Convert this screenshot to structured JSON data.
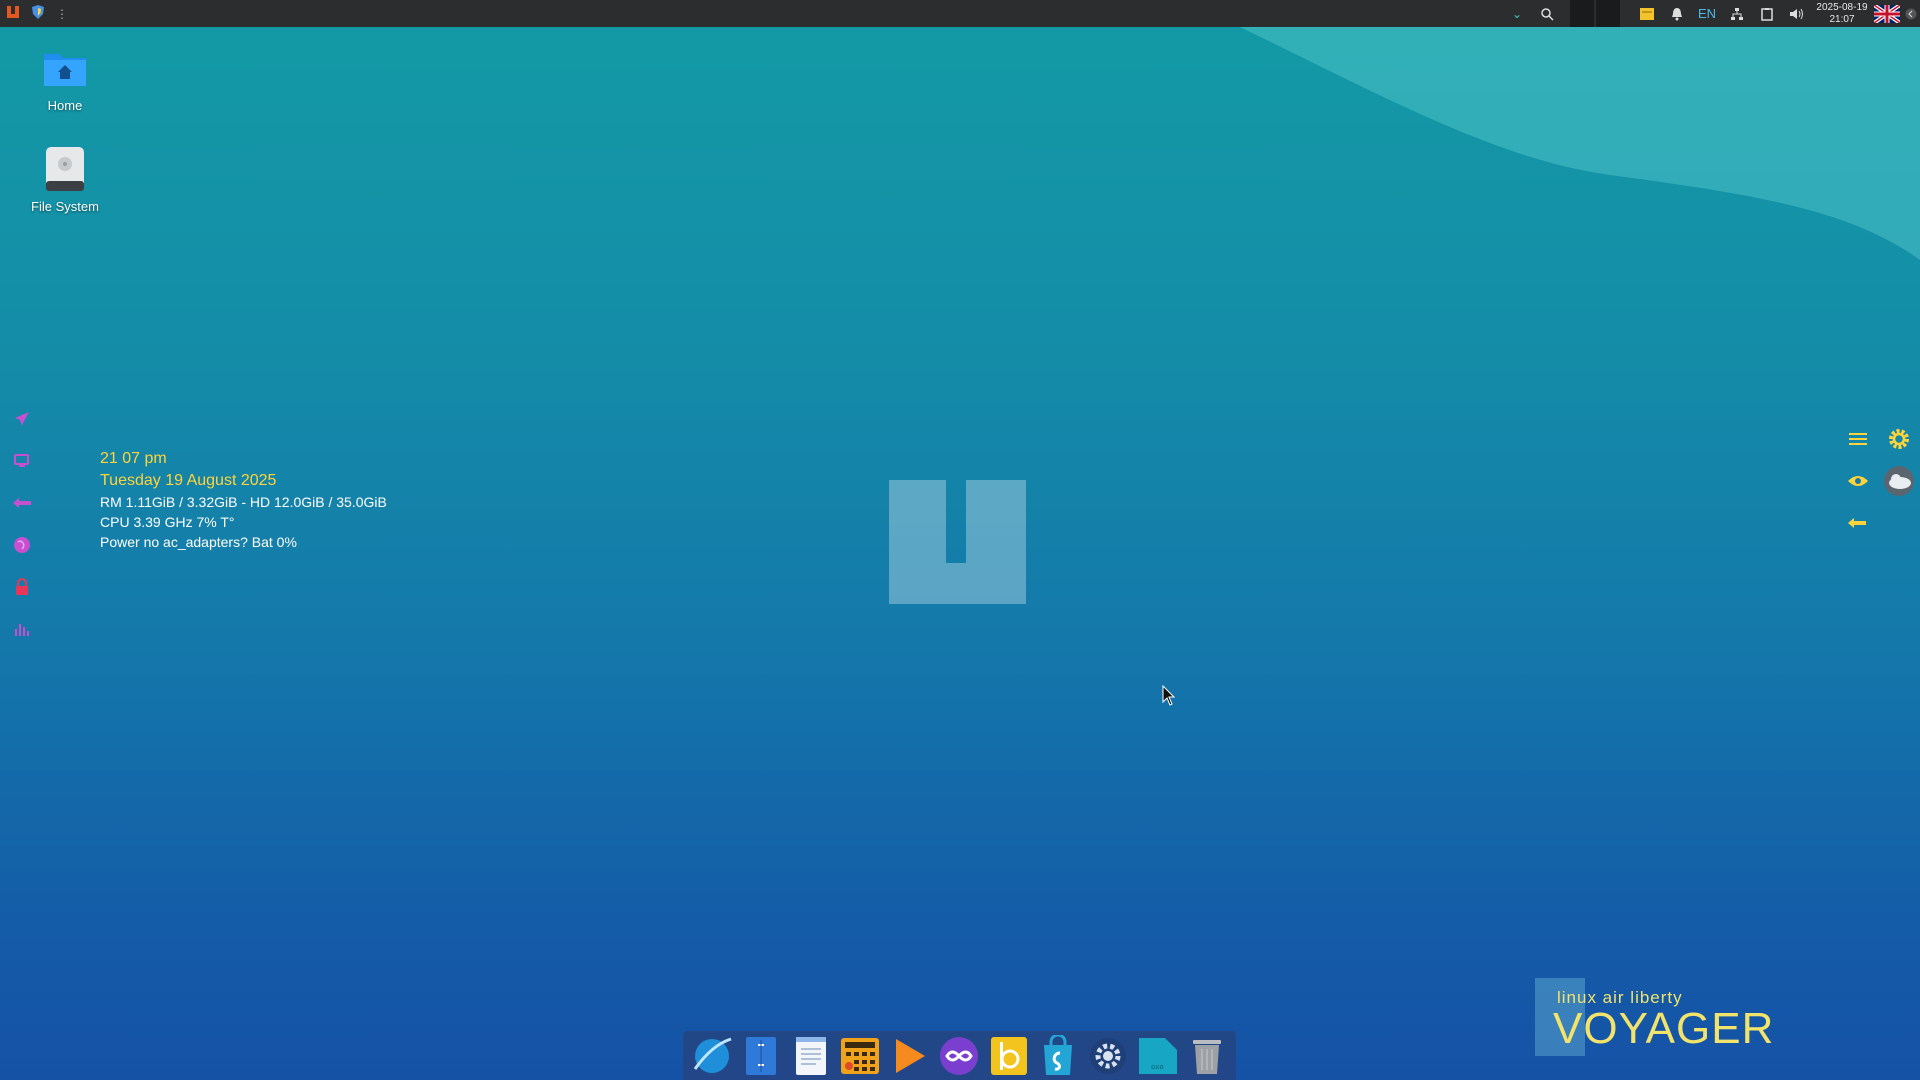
{
  "top_panel": {
    "menu_icon": "app-menu-icon",
    "shield_icon": "shield-icon",
    "overflow_icon": "vertical-dots-icon",
    "right_icons": [
      "chevron-down-icon",
      "search-icon",
      "workspace-switcher",
      "notes-icon",
      "bell-icon",
      "network-icon",
      "clipboard-icon",
      "volume-icon"
    ],
    "keyboard_layout": "EN",
    "date": "2025-08-19",
    "time": "21:07",
    "flag_icon": "uk-flag-icon",
    "collapse_icon": "chevron-left-icon"
  },
  "desktop_icons": [
    {
      "label": "Home",
      "icon": "home-folder-icon"
    },
    {
      "label": "File System",
      "icon": "drive-icon"
    }
  ],
  "left_launcher": [
    "airplane-icon",
    "screen-icon",
    "arrow-left-icon",
    "globe-icon",
    "lock-icon",
    "stats-icon"
  ],
  "conky": {
    "time": "21 07 pm",
    "date": "Tuesday 19 August 2025",
    "mem": "RM 1.11GiB / 3.32GiB - HD 12.0GiB / 35.0GiB",
    "cpu": "CPU 3.39 GHz 7%  T°",
    "power": "Power no ac_adapters? Bat 0%"
  },
  "right_panel": [
    "menu-lines-icon",
    "gear-icon",
    "eye-icon",
    "weather-icon",
    "arrow-left-icon"
  ],
  "dock_apps": [
    "browser-icon",
    "file-manager-icon",
    "text-editor-icon",
    "calculator-icon",
    "media-player-icon",
    "linux-air-icon",
    "office-icon",
    "app-store-icon",
    "settings-icon",
    "terminal-icon",
    "trash-icon"
  ],
  "branding": {
    "small": "linux air liberty",
    "big": "VOYAGER"
  },
  "colors": {
    "panel_bg": "#2b2d2f",
    "conky_accent": "#ffd43a",
    "brand_accent": "#f2e36a",
    "launcher_magenta": "#c94fd1"
  }
}
